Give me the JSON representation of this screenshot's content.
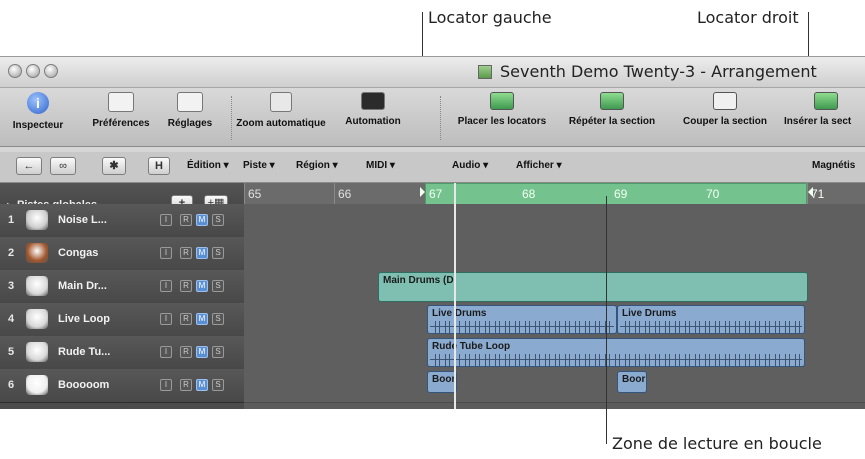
{
  "callouts": {
    "left_locator": "Locator gauche",
    "right_locator": "Locator droit",
    "cycle_zone": "Zone de lecture en boucle"
  },
  "window": {
    "title": "Seventh Demo Twenty-3 - Arrangement"
  },
  "toolbar": {
    "inspector": "Inspecteur",
    "preferences": "Préférences",
    "settings": "Réglages",
    "zoom": "Zoom automatique",
    "automation": "Automation",
    "set_locators": "Placer les locators",
    "repeat_section": "Répéter la section",
    "cut_section": "Couper la section",
    "insert_section": "Insérer la sect"
  },
  "menubar": {
    "edit": "Édition",
    "track": "Piste",
    "region": "Région",
    "midi": "MIDI",
    "audio": "Audio",
    "view": "Afficher",
    "snap": "Magnétis"
  },
  "globals": {
    "label": "Pistes globales",
    "add": "+"
  },
  "ruler": {
    "bars": [
      "65",
      "66",
      "67",
      "68",
      "69",
      "70",
      "71"
    ]
  },
  "tracks": [
    {
      "num": "1",
      "name": "Noise L..."
    },
    {
      "num": "2",
      "name": "Congas"
    },
    {
      "num": "3",
      "name": "Main Dr..."
    },
    {
      "num": "4",
      "name": "Live Loop"
    },
    {
      "num": "5",
      "name": "Rude Tu..."
    },
    {
      "num": "6",
      "name": "Booooom"
    }
  ],
  "track_buttons": {
    "i": "I",
    "r": "R",
    "m": "M",
    "s": "S"
  },
  "regions": {
    "main_drums": "Main Drums (D",
    "live_drums_1": "Live Drums",
    "live_drums_2": "Live Drums",
    "rude_tube": "Rude Tube Loop",
    "boom_1": "Boor",
    "boom_2": "Boor"
  },
  "colors": {
    "cycle": "#74c38e",
    "midi_region": "#7fbfb2",
    "audio_region": "#8aaad0",
    "mute_active": "#5a8fd4"
  }
}
